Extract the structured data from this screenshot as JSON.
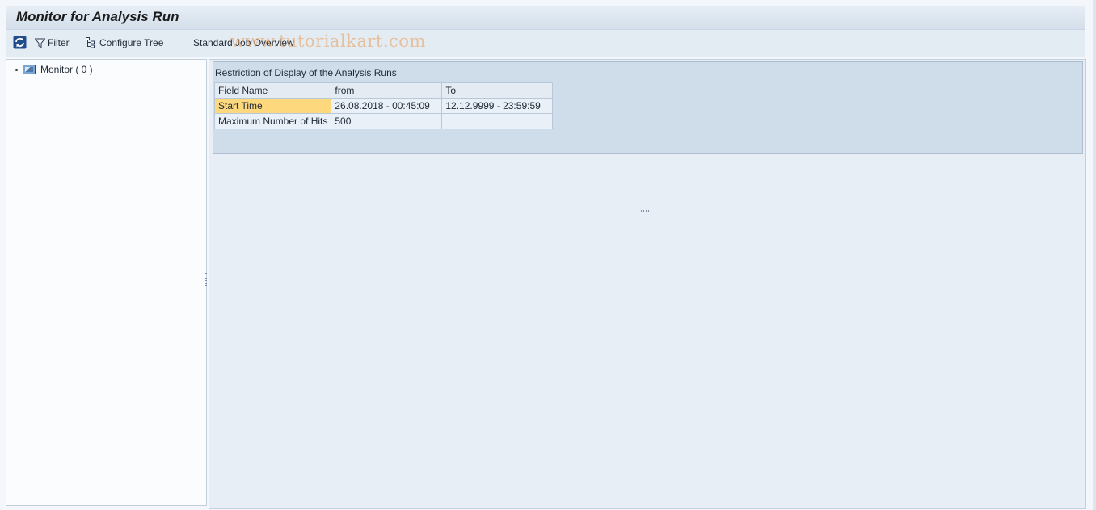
{
  "title": "Monitor for Analysis Run",
  "toolbar": {
    "refresh_icon": "refresh-icon",
    "filter_label": "Filter",
    "configure_tree_label": "Configure Tree",
    "standard_job_overview_label": "Standard Job Overview"
  },
  "watermark": "www.tutorialkart.com",
  "tree": {
    "items": [
      {
        "label": "Monitor ( 0 )",
        "icon": "monitor-icon"
      }
    ]
  },
  "restriction": {
    "title": "Restriction of Display of the Analysis Runs",
    "columns": [
      "Field Name",
      "from",
      "To"
    ],
    "rows": [
      {
        "field": "Start Time",
        "from": "26.08.2018 - 00:45:09",
        "to": "12.12.9999 - 23:59:59",
        "selected": true
      },
      {
        "field": "Maximum Number of Hits",
        "from": "500",
        "to": "",
        "selected": false
      }
    ]
  },
  "colors": {
    "selection": "#fed87c",
    "header_bg": "#d4dfeb",
    "panel_bg": "#cfdcea"
  }
}
